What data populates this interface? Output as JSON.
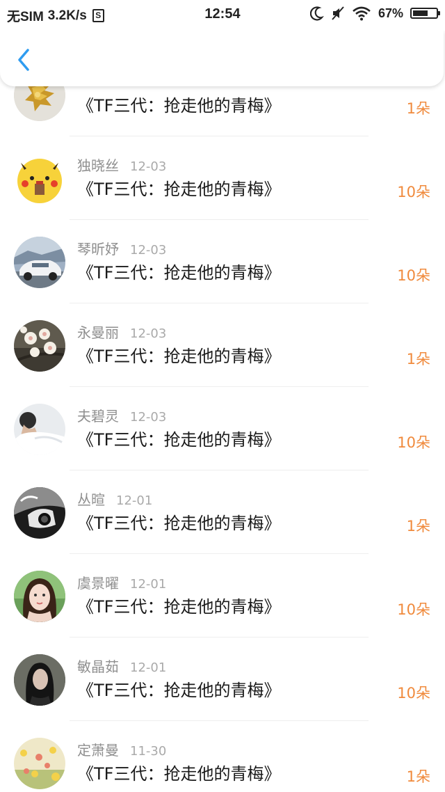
{
  "status_bar": {
    "carrier": "无SIM",
    "speed": "3.2K/s",
    "s_icon_label": "S",
    "time": "12:54",
    "battery_percent": "67%",
    "battery_level": 0.67
  },
  "header": {
    "back_icon": "chevron-left-icon",
    "accent_color": "#2f9cf0"
  },
  "colors": {
    "amount": "#f08a3c",
    "meta": "#999999",
    "title": "#1a1a1a"
  },
  "items": [
    {
      "name": "",
      "date": "",
      "title": "《TF三代：抢走他的青梅》",
      "amount": "1朵",
      "avatar": "gold-ornament"
    },
    {
      "name": "独晓丝",
      "date": "12-03",
      "title": "《TF三代：抢走他的青梅》",
      "amount": "10朵",
      "avatar": "yellow-character"
    },
    {
      "name": "琴昕妤",
      "date": "12-03",
      "title": "《TF三代：抢走他的青梅》",
      "amount": "10朵",
      "avatar": "white-car"
    },
    {
      "name": "永曼丽",
      "date": "12-03",
      "title": "《TF三代：抢走他的青梅》",
      "amount": "1朵",
      "avatar": "white-blossom"
    },
    {
      "name": "夫碧灵",
      "date": "12-03",
      "title": "《TF三代：抢走他的青梅》",
      "amount": "10朵",
      "avatar": "person-white"
    },
    {
      "name": "丛暄",
      "date": "12-01",
      "title": "《TF三代：抢走他的青梅》",
      "amount": "1朵",
      "avatar": "bw-camera"
    },
    {
      "name": "虞景曜",
      "date": "12-01",
      "title": "《TF三代：抢走他的青梅》",
      "amount": "10朵",
      "avatar": "girl-portrait"
    },
    {
      "name": "敏晶茹",
      "date": "12-01",
      "title": "《TF三代：抢走他的青梅》",
      "amount": "10朵",
      "avatar": "dark-hair-girl"
    },
    {
      "name": "定萧曼",
      "date": "11-30",
      "title": "《TF三代：抢走他的青梅》",
      "amount": "1朵",
      "avatar": "flower-field"
    }
  ]
}
